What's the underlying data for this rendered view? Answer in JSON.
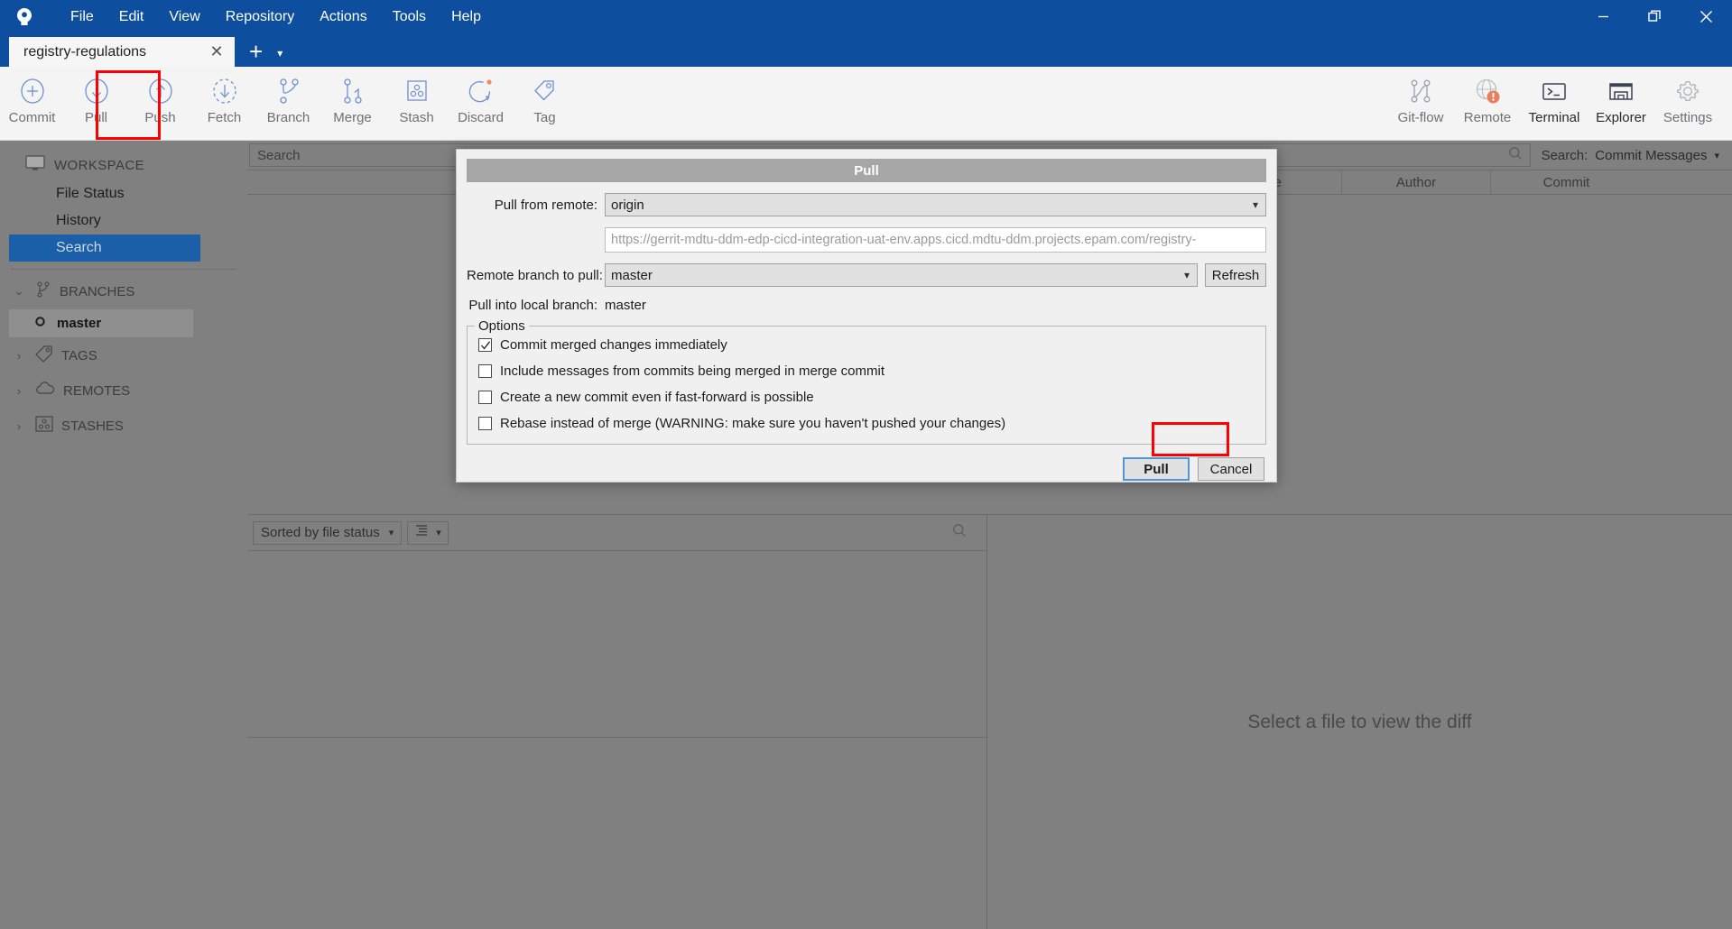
{
  "window": {
    "menu": [
      "File",
      "Edit",
      "View",
      "Repository",
      "Actions",
      "Tools",
      "Help"
    ],
    "controls": {
      "minimize": "minimize-icon",
      "restore": "restore-icon",
      "close": "close-icon"
    },
    "accent_color": "#0d4f9e"
  },
  "tabs": {
    "active": "registry-regulations",
    "close_label": "✕",
    "add_label": "+",
    "caret_label": "▾"
  },
  "toolbar": {
    "left": [
      {
        "label": "Commit",
        "icon": "commit-plus-icon",
        "enabled": false
      },
      {
        "label": "Pull",
        "icon": "pull-down-arrow-icon",
        "enabled": false
      },
      {
        "label": "Push",
        "icon": "push-up-arrow-icon",
        "enabled": false
      },
      {
        "label": "Fetch",
        "icon": "fetch-dashed-arrow-icon",
        "enabled": false
      },
      {
        "label": "Branch",
        "icon": "branch-icon",
        "enabled": false
      },
      {
        "label": "Merge",
        "icon": "merge-icon",
        "enabled": false
      },
      {
        "label": "Stash",
        "icon": "stash-icon",
        "enabled": false
      },
      {
        "label": "Discard",
        "icon": "discard-refresh-icon",
        "enabled": false
      },
      {
        "label": "Tag",
        "icon": "tag-icon",
        "enabled": false
      }
    ],
    "right": [
      {
        "label": "Git-flow",
        "icon": "git-flow-icon",
        "enabled": false
      },
      {
        "label": "Remote",
        "icon": "remote-globe-alert-icon",
        "enabled": false
      },
      {
        "label": "Terminal",
        "icon": "terminal-icon",
        "enabled": true
      },
      {
        "label": "Explorer",
        "icon": "explorer-folder-icon",
        "enabled": true
      },
      {
        "label": "Settings",
        "icon": "gear-icon",
        "enabled": false
      }
    ],
    "highlight_color": "#ff0000",
    "highlighted_item": "Pull"
  },
  "sidebar": {
    "workspace": {
      "label": "WORKSPACE",
      "icon": "monitor-icon"
    },
    "workspace_items": [
      {
        "label": "File Status",
        "active": false
      },
      {
        "label": "History",
        "active": false
      },
      {
        "label": "Search",
        "active": true
      }
    ],
    "sections": [
      {
        "label": "BRANCHES",
        "icon": "branch-icon",
        "expanded": true,
        "chevron": "⌄"
      },
      {
        "label": "TAGS",
        "icon": "tag-icon",
        "expanded": false,
        "chevron": "›"
      },
      {
        "label": "REMOTES",
        "icon": "cloud-icon",
        "expanded": false,
        "chevron": "›"
      },
      {
        "label": "STASHES",
        "icon": "stash-icon",
        "expanded": false,
        "chevron": "›"
      }
    ],
    "branch": {
      "label": "master",
      "icon": "current-branch-dot-icon"
    }
  },
  "search_panel": {
    "placeholder": "Search",
    "value": "",
    "scope_label": "Search:",
    "scope_value": "Commit Messages",
    "magnifier_icon": "search-icon"
  },
  "commit_table": {
    "columns": [
      "",
      "Date",
      "Author",
      "Commit"
    ]
  },
  "file_panel": {
    "sort_label": "Sorted by file status",
    "view_icon": "list-view-icon",
    "magnifier_icon": "search-icon"
  },
  "diff_panel": {
    "empty_message": "Select a file to view the diff"
  },
  "dialog": {
    "title": "Pull",
    "remote_label": "Pull from remote:",
    "remote_value": "origin",
    "remote_url": "https://gerrit-mdtu-ddm-edp-cicd-integration-uat-env.apps.cicd.mdtu-ddm.projects.epam.com/registry-",
    "branch_label": "Remote branch to pull:",
    "branch_value": "master",
    "refresh_label": "Refresh",
    "local_branch_label": "Pull into local branch:",
    "local_branch_value": "master",
    "options_legend": "Options",
    "options": [
      {
        "label": "Commit merged changes immediately",
        "checked": true
      },
      {
        "label": "Include messages from commits being merged in merge commit",
        "checked": false
      },
      {
        "label": "Create a new commit even if fast-forward is possible",
        "checked": false
      },
      {
        "label": "Rebase instead of merge (WARNING: make sure you haven't pushed your changes)",
        "checked": false
      }
    ],
    "confirm_label": "Pull",
    "cancel_label": "Cancel",
    "highlight_color": "#ff0000"
  }
}
